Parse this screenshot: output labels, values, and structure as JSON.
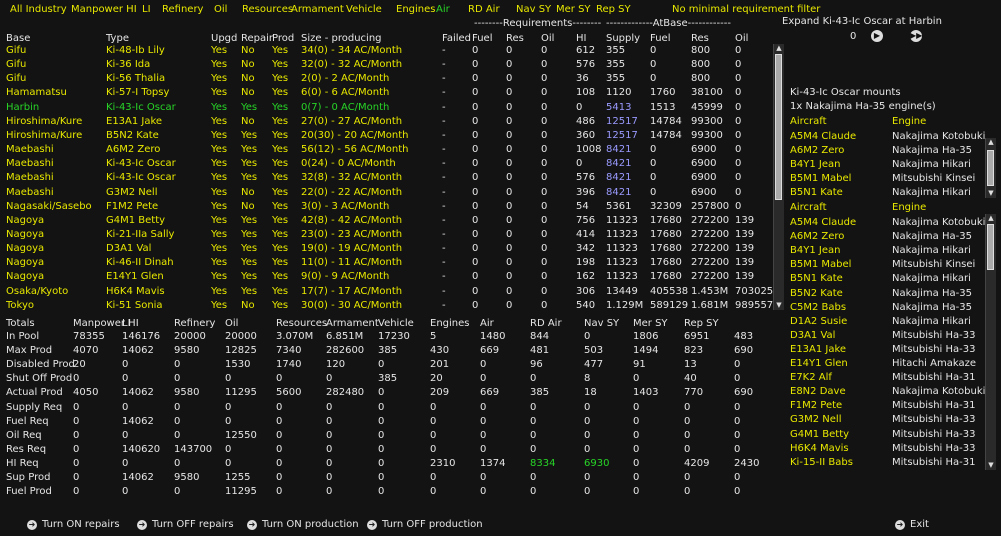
{
  "filters": [
    "All Industry",
    "Manpower HI",
    "LI",
    "Refinery",
    "Oil",
    "Resources",
    "Armament",
    "Vehicle",
    "Engines",
    "Air",
    "RD Air",
    "Nav SY",
    "Mer SY",
    "Rep SY",
    "No minimal requirement filter"
  ],
  "group_headers": {
    "requirements": "--------Requirements--------",
    "atbase": "-------------AtBase------------"
  },
  "columns": [
    "Base",
    "Type",
    "Upgd",
    "Repair",
    "Prod",
    "Size - producing",
    "Failed",
    "Fuel",
    "Res",
    "Oil",
    "HI",
    "Supply",
    "Fuel",
    "Res",
    "Oil"
  ],
  "rows": [
    {
      "base": "Gifu",
      "type": "Ki-48-Ib Lily",
      "upgd": "Yes",
      "repair": "No",
      "prod": "Yes",
      "size": "34(0) - 34 AC/Month",
      "failed": "-",
      "fuel": "0",
      "res": "0",
      "oil": "0",
      "hi": "612",
      "supply": "355",
      "afuel": "0",
      "ares": "800",
      "aoil": "0",
      "hl": false,
      "supply_p": false
    },
    {
      "base": "Gifu",
      "type": "Ki-36 Ida",
      "upgd": "Yes",
      "repair": "No",
      "prod": "Yes",
      "size": "32(0) - 32 AC/Month",
      "failed": "-",
      "fuel": "0",
      "res": "0",
      "oil": "0",
      "hi": "576",
      "supply": "355",
      "afuel": "0",
      "ares": "800",
      "aoil": "0",
      "hl": false,
      "supply_p": false
    },
    {
      "base": "Gifu",
      "type": "Ki-56 Thalia",
      "upgd": "Yes",
      "repair": "No",
      "prod": "Yes",
      "size": "2(0) - 2 AC/Month",
      "failed": "-",
      "fuel": "0",
      "res": "0",
      "oil": "0",
      "hi": "36",
      "supply": "355",
      "afuel": "0",
      "ares": "800",
      "aoil": "0",
      "hl": false,
      "supply_p": false
    },
    {
      "base": "Hamamatsu",
      "type": "Ki-57-I Topsy",
      "upgd": "Yes",
      "repair": "No",
      "prod": "Yes",
      "size": "6(0) - 6 AC/Month",
      "failed": "-",
      "fuel": "0",
      "res": "0",
      "oil": "0",
      "hi": "108",
      "supply": "1120",
      "afuel": "1760",
      "ares": "38100",
      "aoil": "0",
      "hl": false,
      "supply_p": false
    },
    {
      "base": "Harbin",
      "type": "Ki-43-Ic Oscar",
      "upgd": "Yes",
      "repair": "Yes",
      "prod": "Yes",
      "size": "0(7) - 0 AC/Month",
      "failed": "-",
      "fuel": "0",
      "res": "0",
      "oil": "0",
      "hi": "0",
      "supply": "5413",
      "afuel": "1513",
      "ares": "45999",
      "aoil": "0",
      "hl": true,
      "supply_p": true
    },
    {
      "base": "Hiroshima/Kure",
      "type": "E13A1 Jake",
      "upgd": "Yes",
      "repair": "No",
      "prod": "Yes",
      "size": "27(0) - 27 AC/Month",
      "failed": "-",
      "fuel": "0",
      "res": "0",
      "oil": "0",
      "hi": "486",
      "supply": "12517",
      "afuel": "14784",
      "ares": "99300",
      "aoil": "0",
      "hl": false,
      "supply_p": true
    },
    {
      "base": "Hiroshima/Kure",
      "type": "B5N2 Kate",
      "upgd": "Yes",
      "repair": "Yes",
      "prod": "Yes",
      "size": "20(30) - 20 AC/Month",
      "failed": "-",
      "fuel": "0",
      "res": "0",
      "oil": "0",
      "hi": "360",
      "supply": "12517",
      "afuel": "14784",
      "ares": "99300",
      "aoil": "0",
      "hl": false,
      "supply_p": true
    },
    {
      "base": "Maebashi",
      "type": "A6M2 Zero",
      "upgd": "Yes",
      "repair": "Yes",
      "prod": "Yes",
      "size": "56(12) - 56 AC/Month",
      "failed": "-",
      "fuel": "0",
      "res": "0",
      "oil": "0",
      "hi": "1008",
      "supply": "8421",
      "afuel": "0",
      "ares": "6900",
      "aoil": "0",
      "hl": false,
      "supply_p": true
    },
    {
      "base": "Maebashi",
      "type": "Ki-43-Ic Oscar",
      "upgd": "Yes",
      "repair": "Yes",
      "prod": "Yes",
      "size": "0(24) - 0 AC/Month",
      "failed": "-",
      "fuel": "0",
      "res": "0",
      "oil": "0",
      "hi": "0",
      "supply": "8421",
      "afuel": "0",
      "ares": "6900",
      "aoil": "0",
      "hl": false,
      "supply_p": true
    },
    {
      "base": "Maebashi",
      "type": "Ki-43-Ic Oscar",
      "upgd": "Yes",
      "repair": "Yes",
      "prod": "Yes",
      "size": "32(8) - 32 AC/Month",
      "failed": "-",
      "fuel": "0",
      "res": "0",
      "oil": "0",
      "hi": "576",
      "supply": "8421",
      "afuel": "0",
      "ares": "6900",
      "aoil": "0",
      "hl": false,
      "supply_p": true
    },
    {
      "base": "Maebashi",
      "type": "G3M2 Nell",
      "upgd": "Yes",
      "repair": "No",
      "prod": "Yes",
      "size": "22(0) - 22 AC/Month",
      "failed": "-",
      "fuel": "0",
      "res": "0",
      "oil": "0",
      "hi": "396",
      "supply": "8421",
      "afuel": "0",
      "ares": "6900",
      "aoil": "0",
      "hl": false,
      "supply_p": true
    },
    {
      "base": "Nagasaki/Sasebo",
      "type": "F1M2 Pete",
      "upgd": "Yes",
      "repair": "No",
      "prod": "Yes",
      "size": "3(0) - 3 AC/Month",
      "failed": "-",
      "fuel": "0",
      "res": "0",
      "oil": "0",
      "hi": "54",
      "supply": "5361",
      "afuel": "32309",
      "ares": "257800",
      "aoil": "0",
      "hl": false,
      "supply_p": false
    },
    {
      "base": "Nagoya",
      "type": "G4M1 Betty",
      "upgd": "Yes",
      "repair": "Yes",
      "prod": "Yes",
      "size": "42(8) - 42 AC/Month",
      "failed": "-",
      "fuel": "0",
      "res": "0",
      "oil": "0",
      "hi": "756",
      "supply": "11323",
      "afuel": "17680",
      "ares": "272200",
      "aoil": "139",
      "hl": false,
      "supply_p": false
    },
    {
      "base": "Nagoya",
      "type": "Ki-21-IIa Sally",
      "upgd": "Yes",
      "repair": "Yes",
      "prod": "Yes",
      "size": "23(0) - 23 AC/Month",
      "failed": "-",
      "fuel": "0",
      "res": "0",
      "oil": "0",
      "hi": "414",
      "supply": "11323",
      "afuel": "17680",
      "ares": "272200",
      "aoil": "139",
      "hl": false,
      "supply_p": false
    },
    {
      "base": "Nagoya",
      "type": "D3A1 Val",
      "upgd": "Yes",
      "repair": "Yes",
      "prod": "Yes",
      "size": "19(0) - 19 AC/Month",
      "failed": "-",
      "fuel": "0",
      "res": "0",
      "oil": "0",
      "hi": "342",
      "supply": "11323",
      "afuel": "17680",
      "ares": "272200",
      "aoil": "139",
      "hl": false,
      "supply_p": false
    },
    {
      "base": "Nagoya",
      "type": "Ki-46-II Dinah",
      "upgd": "Yes",
      "repair": "Yes",
      "prod": "Yes",
      "size": "11(0) - 11 AC/Month",
      "failed": "-",
      "fuel": "0",
      "res": "0",
      "oil": "0",
      "hi": "198",
      "supply": "11323",
      "afuel": "17680",
      "ares": "272200",
      "aoil": "139",
      "hl": false,
      "supply_p": false
    },
    {
      "base": "Nagoya",
      "type": "E14Y1 Glen",
      "upgd": "Yes",
      "repair": "Yes",
      "prod": "Yes",
      "size": "9(0) - 9 AC/Month",
      "failed": "-",
      "fuel": "0",
      "res": "0",
      "oil": "0",
      "hi": "162",
      "supply": "11323",
      "afuel": "17680",
      "ares": "272200",
      "aoil": "139",
      "hl": false,
      "supply_p": false
    },
    {
      "base": "Osaka/Kyoto",
      "type": "H6K4 Mavis",
      "upgd": "Yes",
      "repair": "Yes",
      "prod": "Yes",
      "size": "17(7) - 17 AC/Month",
      "failed": "-",
      "fuel": "0",
      "res": "0",
      "oil": "0",
      "hi": "306",
      "supply": "13449",
      "afuel": "405538",
      "ares": "1.453M",
      "aoil": "703025",
      "hl": false,
      "supply_p": false
    },
    {
      "base": "Tokyo",
      "type": "Ki-51 Sonia",
      "upgd": "Yes",
      "repair": "No",
      "prod": "Yes",
      "size": "30(0) - 30 AC/Month",
      "failed": "-",
      "fuel": "0",
      "res": "0",
      "oil": "0",
      "hi": "540",
      "supply": "1.129M",
      "afuel": "589129",
      "ares": "1.681M",
      "aoil": "989557",
      "hl": false,
      "supply_p": false
    }
  ],
  "totals": {
    "headers": [
      "Totals",
      "Manpower HI",
      "LI",
      "Refinery",
      "Oil",
      "Resources",
      "Armament",
      "Vehicle",
      "Engines",
      "Air",
      "RD Air",
      "Nav SY",
      "Mer SY",
      "Rep SY"
    ],
    "rows": [
      {
        "label": "In Pool",
        "vals": [
          "78355",
          "146176",
          "20000",
          "20000",
          "3.070M",
          "6.851M",
          "17230",
          "5",
          "1480",
          "844",
          "0",
          "1806",
          "6951",
          "483"
        ]
      },
      {
        "label": "Max Prod",
        "vals": [
          "4070",
          "14062",
          "9580",
          "12825",
          "7340",
          "282600",
          "385",
          "430",
          "669",
          "481",
          "503",
          "1494",
          "823",
          "690"
        ]
      },
      {
        "label": "Disabled Prod",
        "vals": [
          "20",
          "0",
          "0",
          "1530",
          "1740",
          "120",
          "0",
          "201",
          "0",
          "96",
          "477",
          "91",
          "13",
          "0"
        ]
      },
      {
        "label": "Shut Off Prod",
        "vals": [
          "0",
          "0",
          "0",
          "0",
          "0",
          "0",
          "385",
          "20",
          "0",
          "0",
          "8",
          "0",
          "40",
          "0"
        ]
      },
      {
        "label": "Actual Prod",
        "vals": [
          "4050",
          "14062",
          "9580",
          "11295",
          "5600",
          "282480",
          "0",
          "209",
          "669",
          "385",
          "18",
          "1403",
          "770",
          "690"
        ]
      },
      {
        "label": "Supply Req",
        "vals": [
          "0",
          "0",
          "0",
          "0",
          "0",
          "0",
          "0",
          "0",
          "0",
          "0",
          "0",
          "0",
          "0",
          "0"
        ]
      },
      {
        "label": "Fuel Req",
        "vals": [
          "0",
          "14062",
          "0",
          "0",
          "0",
          "0",
          "0",
          "0",
          "0",
          "0",
          "0",
          "0",
          "0",
          "0"
        ]
      },
      {
        "label": "Oil Req",
        "vals": [
          "0",
          "0",
          "0",
          "12550",
          "0",
          "0",
          "0",
          "0",
          "0",
          "0",
          "0",
          "0",
          "0",
          "0"
        ]
      },
      {
        "label": "Res Req",
        "vals": [
          "0",
          "140620",
          "143700",
          "0",
          "0",
          "0",
          "0",
          "0",
          "0",
          "0",
          "0",
          "0",
          "0",
          "0"
        ]
      },
      {
        "label": "HI Req",
        "vals": [
          "0",
          "0",
          "0",
          "0",
          "0",
          "0",
          "0",
          "2310",
          "1374",
          "8334",
          "6930",
          "0",
          "4209",
          "2430",
          "0"
        ]
      },
      {
        "label": "Sup Prod",
        "vals": [
          "0",
          "14062",
          "9580",
          "1255",
          "0",
          "0",
          "0",
          "0",
          "0",
          "0",
          "0",
          "0",
          "0",
          "0"
        ]
      },
      {
        "label": "Fuel Prod",
        "vals": [
          "0",
          "0",
          "0",
          "11295",
          "0",
          "0",
          "0",
          "0",
          "0",
          "0",
          "0",
          "0",
          "0",
          "0"
        ]
      }
    ]
  },
  "right_panel": {
    "expand_label": "Expand Ki-43-Ic Oscar at Harbin",
    "expand_value": "0",
    "mounts_title": "Ki-43-Ic Oscar mounts",
    "mounts_line": "1x Nakajima Ha-35 engine(s)",
    "col_aircraft": "Aircraft",
    "col_engine": "Engine",
    "list1": [
      {
        "a": "A5M4 Claude",
        "e": "Nakajima Kotobuki"
      },
      {
        "a": "A6M2 Zero",
        "e": "Nakajima Ha-35"
      },
      {
        "a": "B4Y1 Jean",
        "e": "Nakajima Hikari"
      },
      {
        "a": "B5M1 Mabel",
        "e": "Mitsubishi Kinsei"
      },
      {
        "a": "B5N1 Kate",
        "e": "Nakajima Hikari"
      }
    ],
    "list2": [
      {
        "a": "A5M4 Claude",
        "e": "Nakajima Kotobuki"
      },
      {
        "a": "A6M2 Zero",
        "e": "Nakajima Ha-35"
      },
      {
        "a": "B4Y1 Jean",
        "e": "Nakajima Hikari"
      },
      {
        "a": "B5M1 Mabel",
        "e": "Mitsubishi Kinsei"
      },
      {
        "a": "B5N1 Kate",
        "e": "Nakajima Hikari"
      },
      {
        "a": "B5N2 Kate",
        "e": "Nakajima Ha-35"
      },
      {
        "a": "C5M2 Babs",
        "e": "Nakajima Ha-35"
      },
      {
        "a": "D1A2 Susie",
        "e": "Nakajima Hikari"
      },
      {
        "a": "D3A1 Val",
        "e": "Mitsubishi Ha-33"
      },
      {
        "a": "E13A1 Jake",
        "e": "Mitsubishi Ha-33"
      },
      {
        "a": "E14Y1 Glen",
        "e": "Hitachi Amakaze"
      },
      {
        "a": "E7K2 Alf",
        "e": "Mitsubishi Ha-31"
      },
      {
        "a": "E8N2 Dave",
        "e": "Nakajima Kotobuki"
      },
      {
        "a": "F1M2 Pete",
        "e": "Mitsubishi Ha-31"
      },
      {
        "a": "G3M2 Nell",
        "e": "Mitsubishi Ha-33"
      },
      {
        "a": "G4M1 Betty",
        "e": "Mitsubishi Ha-33"
      },
      {
        "a": "H6K4 Mavis",
        "e": "Mitsubishi Ha-33"
      },
      {
        "a": "Ki-15-II Babs",
        "e": "Mitsubishi Ha-31"
      }
    ]
  },
  "buttons": {
    "on_repairs": "Turn ON repairs",
    "off_repairs": "Turn OFF repairs",
    "on_production": "Turn ON production",
    "off_production": "Turn OFF production",
    "exit": "Exit"
  },
  "colors": {
    "yellow": "#e8e800",
    "green": "#27d427",
    "purple": "#9a9aff",
    "white": "#e6e6e6",
    "background": "#131313"
  }
}
